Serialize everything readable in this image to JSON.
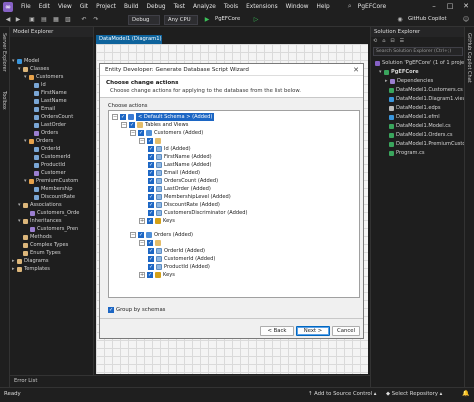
{
  "menu": {
    "items": [
      "File",
      "Edit",
      "View",
      "Git",
      "Project",
      "Build",
      "Debug",
      "Test",
      "Analyze",
      "Tools",
      "Extensions",
      "Window",
      "Help"
    ],
    "app_title": "PgEFCore"
  },
  "toolbar": {
    "config": "Debug",
    "platform": "Any CPU",
    "run_target": "PgEFCore",
    "copilot": "GitHub Copilot"
  },
  "left_rail": {
    "server_explorer": "Server Explorer",
    "toolbox": "Toolbox"
  },
  "model_explorer": {
    "title": "Model Explorer",
    "nodes": [
      "Model",
      "Classes",
      "Customers",
      "Id",
      "FirstName",
      "LastName",
      "Email",
      "OrdersCount",
      "LastOrder",
      "Orders",
      "Orders",
      "OrderId",
      "CustomerId",
      "ProductId",
      "Customer",
      "PremiumCustom",
      "Membership",
      "DiscountRate",
      "Associations",
      "Customers_Orde",
      "Inheritances",
      "Customers_Pren",
      "Methods",
      "Complex Types",
      "Enum Types",
      "Diagrams",
      "Templates"
    ]
  },
  "document": {
    "tab_label": "DataModel1 (Diagram1)"
  },
  "wizard": {
    "title": "Entity Developer: Generate Database Script Wizard",
    "header_title": "Choose change actions",
    "header_subtitle": "Choose change actions for applying to the database from the list below.",
    "group_label": "Choose actions",
    "tree": [
      "< Default Schema > (Added)",
      "Tables and Views",
      "Customers (Added)",
      "Id (Added)",
      "FirstName (Added)",
      "LastName (Added)",
      "Email (Added)",
      "OrdersCount (Added)",
      "LastOrder (Added)",
      "MembershipLevel (Added)",
      "DiscountRate (Added)",
      "CustomersDiscriminator (Added)",
      "Keys",
      "Orders (Added)",
      "OrderId (Added)",
      "CustomerId (Added)",
      "ProductId (Added)",
      "Keys"
    ],
    "group_by_schemas": "Group by schemas",
    "buttons": {
      "back": "< Back",
      "next": "Next >",
      "cancel": "Cancel"
    }
  },
  "solution_explorer": {
    "title": "Solution Explorer",
    "search_placeholder": "Search Solution Explorer (Ctrl+;)",
    "solution_line": "Solution 'PgEFCore' (1 of 1 project)",
    "items": [
      "PgEFCore",
      "Dependencies",
      "DataModel1.Customers.cs",
      "DataModel1.Diagram1.view",
      "DataModel1.edps",
      "DataModel1.efml",
      "DataModel1.Model.cs",
      "DataModel1.Orders.cs",
      "DataModel1.PremiumCustom",
      "Program.cs"
    ]
  },
  "right_rail": {
    "label": "GitHub Copilot Chat"
  },
  "bottom": {
    "error_list": "Error List",
    "status": "Ready",
    "source_control": "Add to Source Control",
    "repository": "Select Repository"
  },
  "colors": {
    "accent": "#0e639c",
    "checkbox": "#1c66c4",
    "vs_purple": "#8661c5"
  }
}
